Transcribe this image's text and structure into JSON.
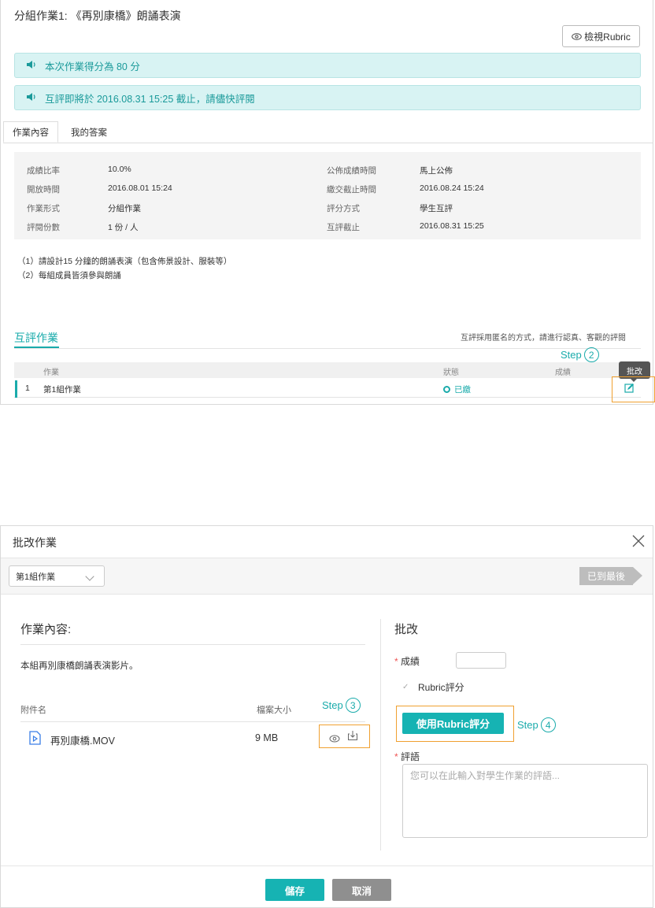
{
  "assignment": {
    "title": "分組作業1: 《再別康橋》朗誦表演",
    "rubric_button": "檢視Rubric",
    "banner_score": "本次作業得分為 80 分",
    "banner_deadline": "互評即將於 2016.08.31 15:25 截止，請儘快評閱",
    "tabs": [
      "作業內容",
      "我的答案"
    ],
    "info": {
      "left": [
        {
          "label": "成績比率",
          "value": "10.0%"
        },
        {
          "label": "開放時間",
          "value": "2016.08.01 15:24"
        },
        {
          "label": "作業形式",
          "value": "分組作業"
        },
        {
          "label": "評閱份數",
          "value": "1 份 / 人"
        }
      ],
      "right": [
        {
          "label": "公佈成績時間",
          "value": "馬上公佈"
        },
        {
          "label": "繳交截止時間",
          "value": "2016.08.24 15:24"
        },
        {
          "label": "評分方式",
          "value": "學生互評"
        },
        {
          "label": "互評截止",
          "value": "2016.08.31 15:25"
        }
      ]
    },
    "description": [
      "（1）請設計15 分鐘的朗誦表演（包含佈景設計、服裝等）",
      "（2）每組成員皆須參與朗誦"
    ]
  },
  "peer_review": {
    "title": "互評作業",
    "note": "互評採用匿名的方式，請進行認真、客觀的評閱",
    "columns": {
      "assignment": "作業",
      "status": "狀態",
      "score": "成績"
    },
    "rows": [
      {
        "index": "1",
        "name": "第1組作業",
        "status": "已繳"
      }
    ],
    "tooltip": "批改"
  },
  "steps": {
    "step2": {
      "label": "Step",
      "num": "2"
    },
    "step3": {
      "label": "Step",
      "num": "3"
    },
    "step4": {
      "label": "Step",
      "num": "4"
    }
  },
  "modal": {
    "title": "批改作業",
    "selector_value": "第1組作業",
    "last_label": "已到最後",
    "left": {
      "title": "作業內容:",
      "description": "本組再別康橋朗誦表演影片。",
      "col_attachment": "附件名",
      "col_size": "檔案大小",
      "file": {
        "name": "再別康橋.MOV",
        "size": "9 MB"
      }
    },
    "right": {
      "title": "批改",
      "score_label": "成績",
      "rubric_checkbox_label": "Rubric評分",
      "use_rubric_button": "使用Rubric評分",
      "comment_label": "評語",
      "comment_placeholder": "您可以在此輸入對學生作業的評語..."
    },
    "save_button": "儲存",
    "cancel_button": "取消"
  },
  "colors": {
    "accent": "#16b3b3",
    "highlight": "#f0a030",
    "banner_bg": "#d8f3f3"
  }
}
